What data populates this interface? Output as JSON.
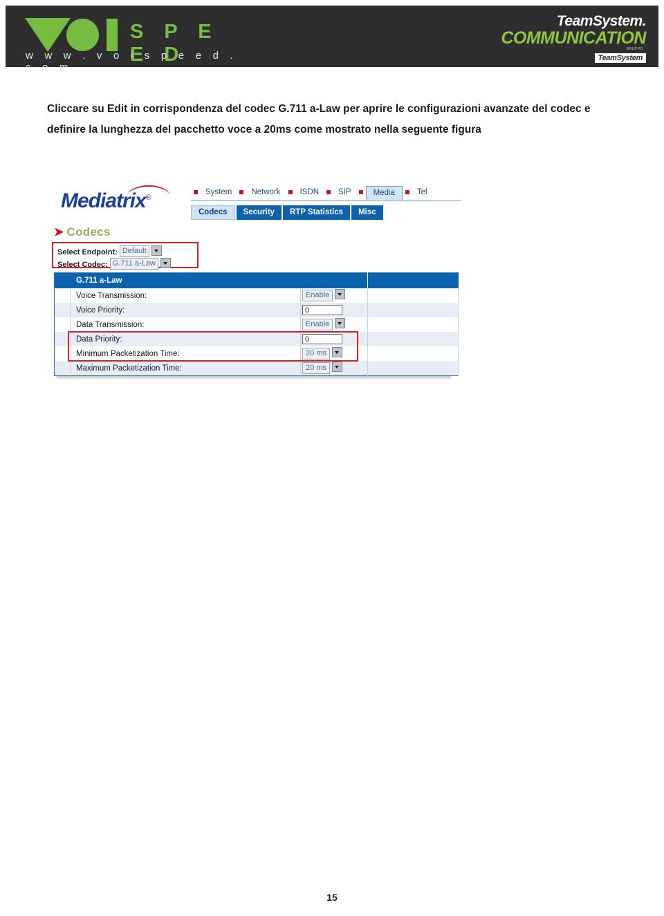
{
  "banner": {
    "voispeed": {
      "wordmark": "S P E E D",
      "url": "w w w . v o i s p e e d . c o m"
    },
    "teamsystem": {
      "name": "TeamSystem.",
      "product": "COMMUNICATION",
      "group_label": "GRUPPO",
      "group_badge": "TeamSystem"
    }
  },
  "body": {
    "paragraph": "Cliccare su Edit in corrispondenza del codec G.711 a-Law per aprire le configurazioni avanzate del codec e definire la lunghezza del pacchetto voce a 20ms come mostrato nella seguente figura"
  },
  "screenshot": {
    "logo": {
      "text": "Mediatrix",
      "registered": "®"
    },
    "top_nav": [
      {
        "label": "System",
        "active": false
      },
      {
        "label": "Network",
        "active": false
      },
      {
        "label": "ISDN",
        "active": false
      },
      {
        "label": "SIP",
        "active": false
      },
      {
        "label": "Media",
        "active": true
      },
      {
        "label": "Tel",
        "active": false
      }
    ],
    "sub_tabs": [
      {
        "label": "Codecs",
        "active": true
      },
      {
        "label": "Security",
        "active": false
      },
      {
        "label": "RTP Statistics",
        "active": false
      },
      {
        "label": "Misc",
        "active": false
      }
    ],
    "section": {
      "arrow": "➤",
      "title": "Codecs"
    },
    "selectors": [
      {
        "label": "Select Endpoint:",
        "value": "Default"
      },
      {
        "label": "Select Codec:",
        "value": "G.711 a-Law"
      }
    ],
    "table": {
      "header": "G.711 a-Law",
      "rows": [
        {
          "label": "Voice Transmission:",
          "value": "Enable",
          "control": "dropdown"
        },
        {
          "label": "Voice Priority:",
          "value": "0",
          "control": "textbox"
        },
        {
          "label": "Data Transmission:",
          "value": "Enable",
          "control": "dropdown"
        },
        {
          "label": "Data Priority:",
          "value": "0",
          "control": "textbox"
        },
        {
          "label": "Minimum Packetization Time:",
          "value": "20 ms",
          "control": "dropdown"
        },
        {
          "label": "Maximum Packetization Time:",
          "value": "20 ms",
          "control": "dropdown"
        }
      ]
    }
  },
  "footer": {
    "page_number": "15"
  },
  "colors": {
    "banner_bg": "#2e2e2e",
    "voispeed_green": "#76bc43",
    "teamsystem_green": "#8dc63f",
    "mediatrix_blue": "#1b3f94",
    "tab_blue": "#0d62ad",
    "tab_active": "#cfe4f3",
    "highlight_red": "#d82020",
    "section_green": "#8fb356"
  }
}
